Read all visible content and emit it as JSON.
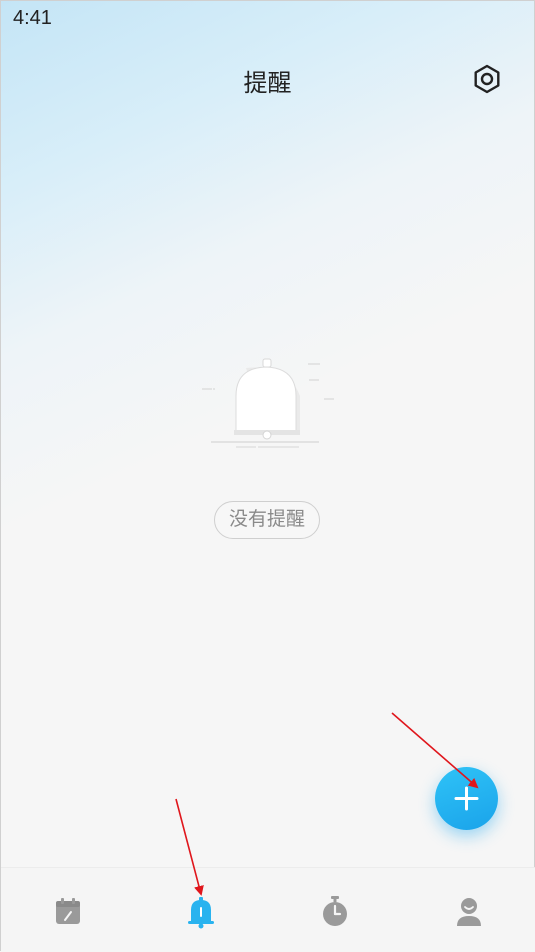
{
  "status_bar": {
    "time": "4:41"
  },
  "header": {
    "title": "提醒",
    "settings_icon": "settings-hexagon-icon"
  },
  "empty_state": {
    "label": "没有提醒",
    "illustration_icon": "bell-illustration-icon"
  },
  "fab": {
    "icon": "plus-icon",
    "color": "#22b3ef"
  },
  "tabbar": {
    "active_color": "#29b3ef",
    "inactive_color": "#9a9a9a",
    "tabs": [
      {
        "icon": "calendar-icon",
        "active": false
      },
      {
        "icon": "bell-icon",
        "active": true
      },
      {
        "icon": "stopwatch-icon",
        "active": false
      },
      {
        "icon": "profile-icon",
        "active": false
      }
    ]
  },
  "annotations": {
    "arrow_color": "#e0161c"
  }
}
